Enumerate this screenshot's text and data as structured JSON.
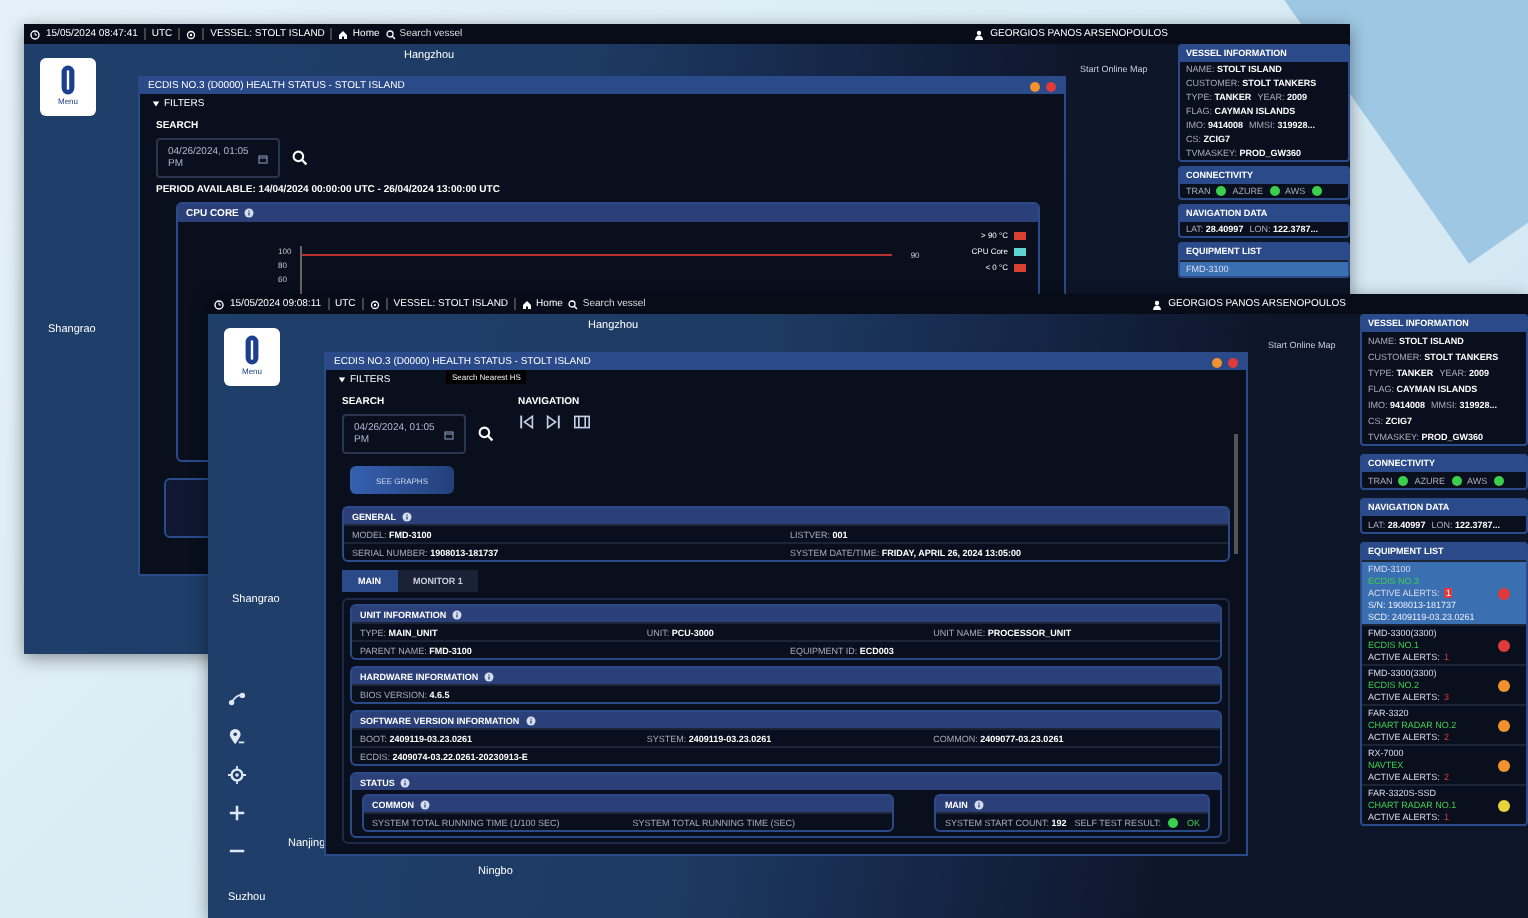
{
  "back_screen": {
    "top_bar": {
      "datetime": "15/05/2024 08:47:41",
      "timezone": "UTC",
      "vessel": "VESSEL: STOLT ISLAND",
      "home": "Home",
      "search_placeholder": "Search vessel",
      "user": "GEORGIOS PANOS ARSENOPOULOS"
    },
    "menu_label": "Menu",
    "map_labels": [
      "Hangzhou",
      "Shangrao"
    ],
    "online_map": "Start Online Map",
    "dialog": {
      "title": "ECDIS NO.3 (D0000) HEALTH STATUS - STOLT ISLAND",
      "filters": "FILTERS",
      "search_label": "SEARCH",
      "date_value": "04/26/2024, 01:05 PM",
      "period": "PERIOD AVAILABLE: 14/04/2024 00:00:00 UTC - 26/04/2024 13:00:00 UTC",
      "chart_title": "CPU CORE",
      "y_ticks": [
        "100",
        "80",
        "60"
      ],
      "threshold_label": "90",
      "legend": [
        {
          "label": "> 90 °C",
          "color": "#d9402f"
        },
        {
          "label": "CPU Core",
          "color": "#5fd3d0"
        },
        {
          "label": "< 0 °C",
          "color": "#d9402f"
        }
      ]
    },
    "vessel_panel": {
      "title": "VESSEL INFORMATION",
      "rows": [
        [
          "NAME: **STOLT ISLAND**"
        ],
        [
          "CUSTOMER: **STOLT TANKERS**"
        ],
        [
          "TYPE: **TANKER**",
          "YEAR: **2009**"
        ],
        [
          "FLAG: **CAYMAN ISLANDS**"
        ],
        [
          "IMO: **9414008**",
          "MMSI: **319928...**"
        ],
        [
          "CS: **ZCIG7**"
        ],
        [
          "TVMASKEY: **PROD_GW360**"
        ]
      ]
    },
    "connectivity": {
      "title": "CONNECTIVITY",
      "links": [
        {
          "label": "TRAN",
          "connected": true
        },
        {
          "label": "AZURE",
          "connected": true
        },
        {
          "label": "AWS",
          "connected": true
        }
      ]
    },
    "navigation": {
      "title": "NAVIGATION DATA",
      "fields": [
        "LAT: **28.40997**",
        "LON: **122.3787...**"
      ]
    },
    "equipment": {
      "title": "EQUIPMENT LIST",
      "items": [
        {
          "model": "FMD-3100",
          "selected": true
        }
      ]
    }
  },
  "front_screen": {
    "top_bar": {
      "datetime": "15/05/2024 09:08:11",
      "timezone": "UTC",
      "vessel": "VESSEL: STOLT ISLAND",
      "home": "Home",
      "search_placeholder": "Search vessel",
      "user": "GEORGIOS PANOS ARSENOPOULOS"
    },
    "menu_label": "Menu",
    "map_labels": [
      "Hangzhou",
      "Shangrao",
      "Nanjing",
      "Ningbo",
      "Suzhou"
    ],
    "online_map": "Start Online Map",
    "dialog": {
      "title": "ECDIS NO.3 (D0000) HEALTH STATUS - STOLT ISLAND",
      "filters": "FILTERS",
      "search_label": "SEARCH",
      "date_value": "04/26/2024, 01:05 PM",
      "tooltip": "Search Nearest HS",
      "navigation_label": "NAVIGATION",
      "see_graphs": "SEE GRAPHS",
      "general": {
        "title": "GENERAL",
        "rows": [
          [
            "MODEL: **FMD-3100**",
            "LISTVER: **001**"
          ],
          [
            "SERIAL NUMBER: **1908013-181737**",
            "SYSTEM DATE/TIME: **FRIDAY, APRIL 26, 2024 13:05:00**"
          ]
        ]
      },
      "tabs": [
        {
          "label": "MAIN",
          "selected": true
        },
        {
          "label": "MONITOR 1",
          "selected": false
        }
      ],
      "sections": [
        {
          "title": "UNIT INFORMATION",
          "rows": [
            [
              "TYPE: **MAIN_UNIT**",
              "UNIT: **PCU-3000**",
              "UNIT NAME: **PROCESSOR_UNIT**"
            ],
            [
              "PARENT NAME: **FMD-3100**",
              "EQUIPMENT ID: **ECD003**"
            ]
          ]
        },
        {
          "title": "HARDWARE INFORMATION",
          "rows": [
            [
              "BIOS VERSION: **4.6.5**"
            ]
          ]
        },
        {
          "title": "SOFTWARE VERSION INFORMATION",
          "rows": [
            [
              "BOOT: **2409119-03.23.0261**",
              "SYSTEM: **2409119-03.23.0261**",
              "COMMON: **2409077-03.23.0261**"
            ],
            [
              "ECDIS: **2409074-03.22.0261-20230913-E**"
            ]
          ]
        }
      ],
      "status": {
        "title": "STATUS",
        "common": {
          "title": "COMMON",
          "fields": [
            "SYSTEM TOTAL RUNNING TIME (1/100 SEC)",
            "SYSTEM TOTAL RUNNING TIME (SEC)"
          ]
        },
        "main": {
          "title": "MAIN",
          "start_count": "SYSTEM START COUNT: **192**",
          "self_test_label": "SELF TEST RESULT:",
          "self_test": "OK",
          "ok": true
        }
      }
    },
    "vessel_panel": {
      "title": "VESSEL INFORMATION",
      "rows": [
        [
          "NAME: **STOLT ISLAND**"
        ],
        [
          "CUSTOMER: **STOLT TANKERS**"
        ],
        [
          "TYPE: **TANKER**",
          "YEAR: **2009**"
        ],
        [
          "FLAG: **CAYMAN ISLANDS**"
        ],
        [
          "IMO: **9414008**",
          "MMSI: **319928...**"
        ],
        [
          "CS: **ZCIG7**"
        ],
        [
          "TVMASKEY: **PROD_GW360**"
        ]
      ]
    },
    "connectivity": {
      "title": "CONNECTIVITY",
      "links": [
        {
          "label": "TRAN",
          "connected": true
        },
        {
          "label": "AZURE",
          "connected": true
        },
        {
          "label": "AWS",
          "connected": true
        }
      ]
    },
    "navigation": {
      "title": "NAVIGATION DATA",
      "fields": [
        "LAT: **28.40997**",
        "LON: **122.3787...**"
      ]
    },
    "equipment": {
      "title": "EQUIPMENT LIST",
      "items": [
        {
          "model": "FMD-3100",
          "name": "ECDIS NO.3",
          "alerts_label": "ACTIVE ALERTS:",
          "alerts": "1",
          "details": [
            "S/N: 1908013-181737",
            "SCD: 2409119-03.23.0261"
          ],
          "color": "#e03a3a",
          "selected": true
        },
        {
          "model": "FMD-3300(3300)",
          "name": "ECDIS NO.1",
          "alerts_label": "ACTIVE ALERTS:",
          "alerts": "1",
          "color": "#e03a3a",
          "selected": false
        },
        {
          "model": "FMD-3300(3300)",
          "name": "ECDIS NO.2",
          "alerts_label": "ACTIVE ALERTS:",
          "alerts": "3",
          "color": "#f0922e",
          "selected": false
        },
        {
          "model": "FAR-3320",
          "name": "CHART RADAR NO.2",
          "alerts_label": "ACTIVE ALERTS:",
          "alerts": "2",
          "color": "#f0922e",
          "selected": false
        },
        {
          "model": "RX-7000",
          "name": "NAVTEX",
          "alerts_label": "ACTIVE ALERTS:",
          "alerts": "2",
          "color": "#f0922e",
          "selected": false
        },
        {
          "model": "FAR-3320S-SSD",
          "name": "CHART RADAR NO.1",
          "alerts_label": "ACTIVE ALERTS:",
          "alerts": "1",
          "color": "#e8d33a",
          "selected": false
        }
      ]
    }
  }
}
